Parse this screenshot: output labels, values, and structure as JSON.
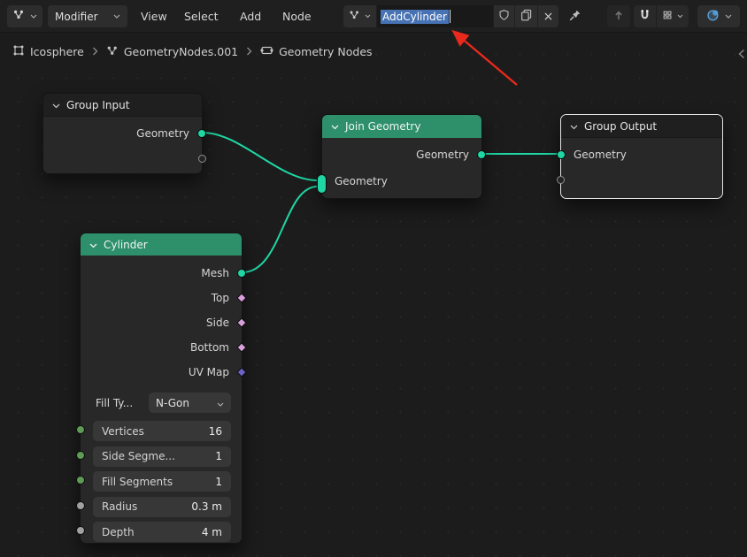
{
  "colors": {
    "selection_blue": "#4772B3",
    "node_header_teal": "#2E8F6B",
    "socket_geometry": "#1FD6A4",
    "socket_boolean_field": "#D9A0DC",
    "socket_vector_field": "#6B63C7",
    "socket_integer": "#5E9B54",
    "socket_float": "#A1A1A1",
    "wire": "#1FD6A4",
    "annotation_arrow_red": "#E8291C"
  },
  "topbar": {
    "mode_dropdown": "Modifier",
    "menus": [
      "View",
      "Select",
      "Add",
      "Node"
    ],
    "id_block": {
      "name_value": "AddCylinder",
      "unlink_label": "×"
    }
  },
  "breadcrumb": {
    "items": [
      {
        "label": "Icosphere"
      },
      {
        "label": "GeometryNodes.001"
      },
      {
        "label": "Geometry Nodes"
      }
    ]
  },
  "nodes": {
    "group_input": {
      "title": "Group Input",
      "output_label": "Geometry"
    },
    "join_geometry": {
      "title": "Join Geometry",
      "output_label": "Geometry",
      "input_label": "Geometry"
    },
    "group_output": {
      "title": "Group Output",
      "input_label": "Geometry"
    },
    "cylinder": {
      "title": "Cylinder",
      "outputs": [
        {
          "label": "Mesh",
          "socket": "geometry"
        },
        {
          "label": "Top",
          "socket": "boolean-field"
        },
        {
          "label": "Side",
          "socket": "boolean-field"
        },
        {
          "label": "Bottom",
          "socket": "boolean-field"
        },
        {
          "label": "UV Map",
          "socket": "vector-field"
        }
      ],
      "fill_type": {
        "label": "Fill Ty...",
        "value": "N-Gon"
      },
      "inputs": [
        {
          "label": "Vertices",
          "value": "16",
          "socket": "integer"
        },
        {
          "label": "Side Segme...",
          "value": "1",
          "socket": "integer"
        },
        {
          "label": "Fill Segments",
          "value": "1",
          "socket": "integer"
        },
        {
          "label": "Radius",
          "value": "0.3 m",
          "socket": "float"
        },
        {
          "label": "Depth",
          "value": "4 m",
          "socket": "float"
        }
      ]
    }
  }
}
